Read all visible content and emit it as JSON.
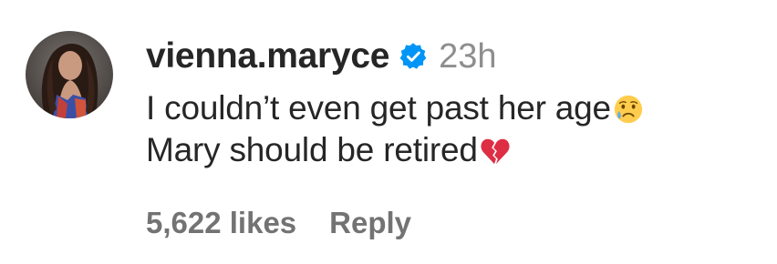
{
  "comment": {
    "avatar_icon": "user-avatar-photo",
    "username": "vienna.maryce",
    "verified_icon": "verified-badge-icon",
    "verified_color": "#0095f6",
    "timestamp": "23h",
    "text_line_1": "I couldn’t even get past her age",
    "emoji_1": "crying-face-emoji",
    "text_line_2": "Mary should be retired",
    "emoji_2": "broken-heart-emoji",
    "likes": "5,622 likes",
    "reply_label": "Reply"
  },
  "colors": {
    "text_primary": "#262626",
    "text_secondary": "#8e8e8e",
    "action_text": "#737373",
    "background": "#ffffff"
  }
}
